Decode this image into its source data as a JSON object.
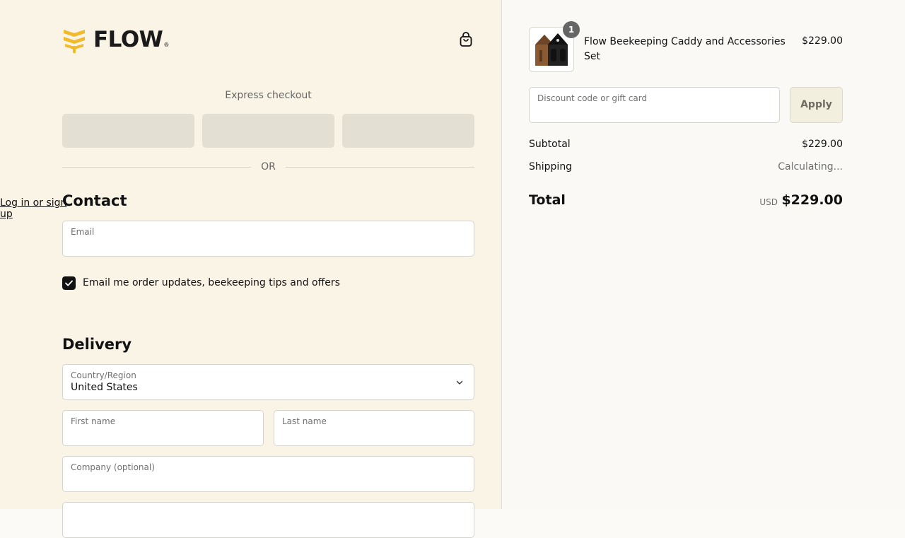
{
  "brand": {
    "name": "FLOW",
    "registered_mark": "®",
    "accent_color": "#f2b928"
  },
  "header": {
    "cart_icon": "shopping-bag-icon"
  },
  "express_checkout": {
    "title": "Express checkout",
    "separator": "OR"
  },
  "contact": {
    "title": "Contact",
    "login_link": "Log in or sign up",
    "email_label": "Email",
    "email_value": "",
    "marketing_opt_in": "Email me order updates, beekeeping tips and offers",
    "marketing_checked": true
  },
  "delivery": {
    "title": "Delivery",
    "country_label": "Country/Region",
    "country_value": "United States",
    "first_name_label": "First name",
    "last_name_label": "Last name",
    "company_label": "Company (optional)"
  },
  "order": {
    "items": [
      {
        "name": "Flow Beekeeping Caddy and Accessories Set",
        "price": "$229.00",
        "quantity": "1"
      }
    ],
    "discount_label": "Discount code or gift card",
    "apply_label": "Apply",
    "subtotal_label": "Subtotal",
    "subtotal_value": "$229.00",
    "shipping_label": "Shipping",
    "shipping_value": "Calculating...",
    "total_label": "Total",
    "total_currency": "USD",
    "total_value": "$229.00"
  }
}
